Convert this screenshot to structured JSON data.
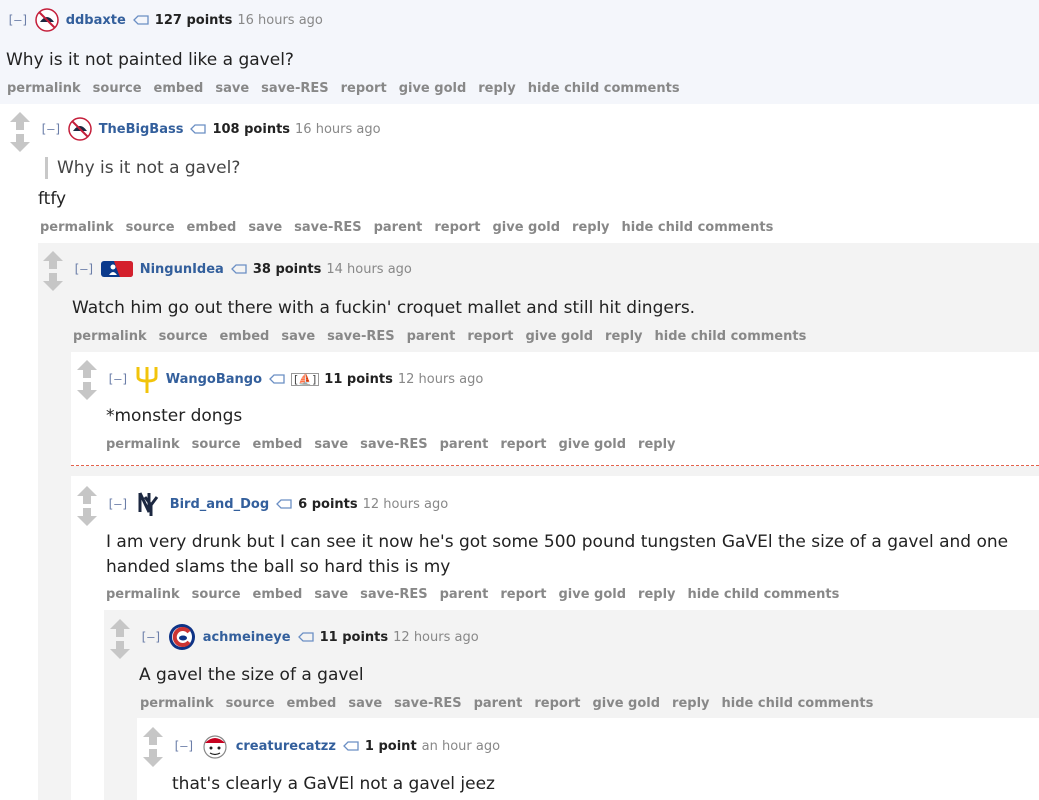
{
  "actions_basic": [
    "permalink",
    "source",
    "embed",
    "save",
    "save-RES",
    "report",
    "give gold",
    "reply",
    "hide child comments"
  ],
  "actions_parent": [
    "permalink",
    "source",
    "embed",
    "save",
    "save-RES",
    "parent",
    "report",
    "give gold",
    "reply",
    "hide child comments"
  ],
  "actions_leaf": [
    "permalink",
    "source",
    "embed",
    "save",
    "save-RES",
    "parent",
    "report",
    "give gold",
    "reply"
  ],
  "collapse_label": "[–]",
  "comments": [
    {
      "user": "ddbaxte",
      "points": "127 points",
      "age": "16 hours ago",
      "text": "Why is it not painted like a gavel?"
    },
    {
      "user": "TheBigBass",
      "points": "108 points",
      "age": "16 hours ago",
      "quote": "Why is it not a gavel?",
      "text": "ftfy"
    },
    {
      "user": "NingunIdea",
      "points": "38 points",
      "age": "14 hours ago",
      "text": "Watch him go out there with a fuckin' croquet mallet and still hit dingers."
    },
    {
      "user": "WangoBango",
      "award": "[⛵]",
      "points": "11 points",
      "age": "12 hours ago",
      "text": "*monster dongs"
    },
    {
      "user": "Bird_and_Dog",
      "points": "6 points",
      "age": "12 hours ago",
      "text": "I am very drunk but I can see it now he's got some 500 pound tungsten GaVEl the size of a gavel and one handed slams the ball so hard this is my"
    },
    {
      "user": "achmeineye",
      "points": "11 points",
      "age": "12 hours ago",
      "text": "A gavel the size of a gavel"
    },
    {
      "user": "creaturecatzz",
      "points": "1 point",
      "age": "an hour ago",
      "text": "that's clearly a GaVEl not a gavel jeez"
    }
  ],
  "colors": {
    "username": "#335f9c",
    "action": "#888888",
    "divider": "#e4624c",
    "tint": "#f4f6fb"
  }
}
